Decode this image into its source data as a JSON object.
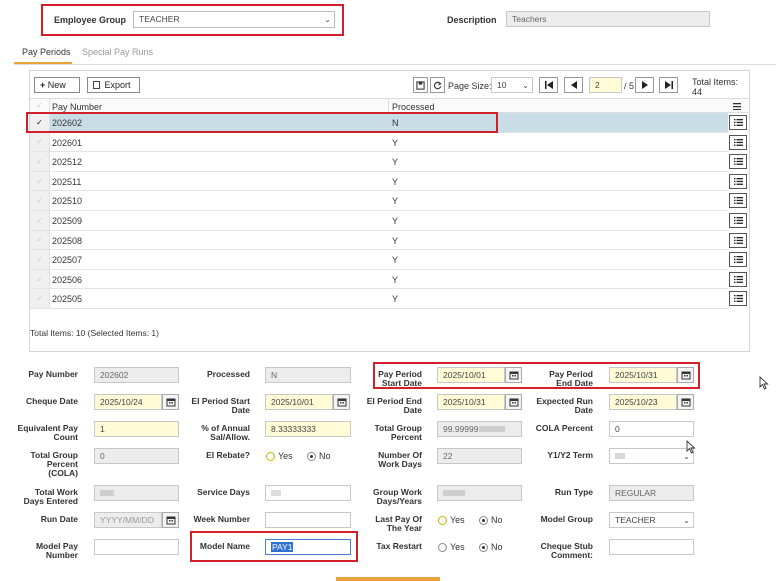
{
  "header": {
    "employee_group_label": "Employee Group",
    "employee_group_value": "TEACHER",
    "description_label": "Description",
    "description_value": "Teachers"
  },
  "tabs": [
    {
      "label": "Pay Periods",
      "active": true
    },
    {
      "label": "Special Pay Runs",
      "active": false
    }
  ],
  "toolbar": {
    "new_label": "New",
    "export_label": "Export",
    "page_size_label": "Page Size:",
    "page_size_value": "10",
    "current_page": "2",
    "page_total": "/ 5",
    "total_items_label": "Total Items: 44"
  },
  "grid": {
    "columns": [
      "Pay Number",
      "Processed"
    ],
    "rows": [
      {
        "pay_number": "202602",
        "processed": "N",
        "selected": true
      },
      {
        "pay_number": "202601",
        "processed": "Y",
        "selected": false
      },
      {
        "pay_number": "202512",
        "processed": "Y",
        "selected": false
      },
      {
        "pay_number": "202511",
        "processed": "Y",
        "selected": false
      },
      {
        "pay_number": "202510",
        "processed": "Y",
        "selected": false
      },
      {
        "pay_number": "202509",
        "processed": "Y",
        "selected": false
      },
      {
        "pay_number": "202508",
        "processed": "Y",
        "selected": false
      },
      {
        "pay_number": "202507",
        "processed": "Y",
        "selected": false
      },
      {
        "pay_number": "202506",
        "processed": "Y",
        "selected": false
      },
      {
        "pay_number": "202505",
        "processed": "Y",
        "selected": false
      }
    ],
    "footer": "Total Items: 10 (Selected Items: 1)"
  },
  "form": {
    "pay_number": {
      "label": "Pay Number",
      "value": "202602"
    },
    "processed": {
      "label": "Processed",
      "value": "N"
    },
    "pay_period_start": {
      "label1": "Pay Period",
      "label2": "Start Date",
      "value": "2025/10/01"
    },
    "pay_period_end": {
      "label1": "Pay Period",
      "label2": "End Date",
      "value": "2025/10/31"
    },
    "cheque_date": {
      "label": "Cheque Date",
      "value": "2025/10/24"
    },
    "ei_period_start": {
      "label1": "EI Period Start",
      "label2": "Date",
      "value": "2025/10/01"
    },
    "ei_period_end": {
      "label1": "EI Period End",
      "label2": "Date",
      "value": "2025/10/31"
    },
    "expected_run": {
      "label1": "Expected Run",
      "label2": "Date",
      "value": "2025/10/23"
    },
    "equiv_pay_count": {
      "label1": "Equivalent Pay",
      "label2": "Count",
      "value": "1"
    },
    "pct_annual": {
      "label1": "% of Annual",
      "label2": "Sal/Allow.",
      "value": "8.33333333"
    },
    "total_group_pct": {
      "label1": "Total Group",
      "label2": "Percent",
      "value": "99.99999"
    },
    "cola_pct": {
      "label": "COLA Percent",
      "value": "0"
    },
    "total_group_pct_cola": {
      "label1": "Total Group",
      "label2": "Percent",
      "label3": "(COLA)",
      "value": "0"
    },
    "ei_rebate": {
      "label": "EI Rebate?",
      "yes": "Yes",
      "no": "No"
    },
    "num_work_days": {
      "label1": "Number Of",
      "label2": "Work Days",
      "value": "22"
    },
    "y1y2_term": {
      "label": "Y1/Y2 Term"
    },
    "total_work_days": {
      "label1": "Total Work",
      "label2": "Days Entered"
    },
    "service_days": {
      "label": "Service Days"
    },
    "group_work_days": {
      "label1": "Group Work",
      "label2": "Days/Years"
    },
    "run_type": {
      "label": "Run Type",
      "value": "REGULAR"
    },
    "run_date": {
      "label": "Run Date",
      "placeholder": "YYYY/MM/DD"
    },
    "week_number": {
      "label": "Week Number"
    },
    "last_pay_of_year": {
      "label1": "Last Pay Of",
      "label2": "The Year",
      "yes": "Yes",
      "no": "No"
    },
    "model_group": {
      "label": "Model Group",
      "value": "TEACHER"
    },
    "model_pay_number": {
      "label1": "Model Pay",
      "label2": "Number"
    },
    "model_name": {
      "label": "Model Name",
      "value": "PAY1"
    },
    "tax_restart": {
      "label": "Tax Restart",
      "yes": "Yes",
      "no": "No"
    },
    "cheque_stub": {
      "label1": "Cheque Stub",
      "label2": "Comment:"
    }
  },
  "colors": {
    "highlight": "#d0212b",
    "selected_row": "#c9dde6",
    "required_field": "#fffbd6",
    "tab_active_underline": "#e8a33d"
  }
}
